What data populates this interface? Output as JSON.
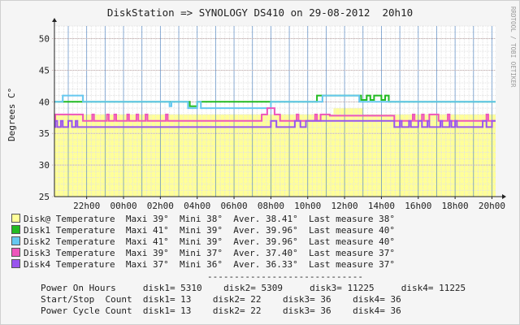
{
  "colors": {
    "background": "#f5f5f5",
    "plot_background": "#ffffff",
    "area_fill": "#ffff99",
    "grid_minor": "#e2e2e2",
    "grid_major": "#c9b2b2",
    "hour_lines": "#2a6bb8",
    "axis": "#222222"
  },
  "chart_data": {
    "type": "line",
    "title": "DiskStation => SYNOLOGY DS410 on 29-08-2012  20h10",
    "ylabel": "Degrees C°",
    "watermark": "RRDTOOL / TOBI OETIKER",
    "ylim": [
      25,
      52
    ],
    "yticks": [
      25,
      30,
      35,
      40,
      45,
      50
    ],
    "xlim": [
      20.25,
      44.2
    ],
    "xticks": [
      {
        "x": 22,
        "label": "22h00"
      },
      {
        "x": 24,
        "label": "00h00"
      },
      {
        "x": 26,
        "label": "02h00"
      },
      {
        "x": 28,
        "label": "04h00"
      },
      {
        "x": 30,
        "label": "06h00"
      },
      {
        "x": 32,
        "label": "08h00"
      },
      {
        "x": 34,
        "label": "10h00"
      },
      {
        "x": 36,
        "label": "12h00"
      },
      {
        "x": 38,
        "label": "14h00"
      },
      {
        "x": 40,
        "label": "16h00"
      },
      {
        "x": 42,
        "label": "18h00"
      },
      {
        "x": 44,
        "label": "20h00"
      }
    ],
    "grid": true,
    "series": [
      {
        "name": "Disk@ Temperature",
        "color": "#ffff99",
        "style": "area",
        "points": [
          [
            20.25,
            38
          ],
          [
            35.4,
            38
          ],
          [
            35.4,
            39
          ],
          [
            37.0,
            39
          ],
          [
            37.0,
            38
          ],
          [
            44.2,
            38
          ]
        ],
        "maxi": "39°",
        "mini": "38°",
        "aver": "38.41°",
        "last": "38°"
      },
      {
        "name": "Disk1 Temperature",
        "color": "#22bb22",
        "style": "line",
        "points": [
          [
            20.25,
            40
          ],
          [
            27.6,
            40
          ],
          [
            27.6,
            39.3
          ],
          [
            28.0,
            39.3
          ],
          [
            28.0,
            40
          ],
          [
            34.5,
            40
          ],
          [
            34.5,
            41
          ],
          [
            36.9,
            41
          ],
          [
            36.9,
            40.3
          ],
          [
            37.2,
            40.3
          ],
          [
            37.2,
            41
          ],
          [
            37.4,
            41
          ],
          [
            37.4,
            40.3
          ],
          [
            37.6,
            40.3
          ],
          [
            37.6,
            41
          ],
          [
            38.0,
            41
          ],
          [
            38.0,
            40.3
          ],
          [
            38.2,
            40.3
          ],
          [
            38.2,
            41
          ],
          [
            38.4,
            41
          ],
          [
            38.4,
            40
          ],
          [
            44.2,
            40
          ]
        ],
        "maxi": "41°",
        "mini": "39°",
        "aver": "39.96°",
        "last": "40°"
      },
      {
        "name": "Disk2 Temperature",
        "color": "#66c8f0",
        "style": "line",
        "points": [
          [
            20.25,
            40
          ],
          [
            20.7,
            40
          ],
          [
            20.7,
            41
          ],
          [
            21.8,
            41
          ],
          [
            21.8,
            40
          ],
          [
            26.5,
            40
          ],
          [
            26.5,
            39.3
          ],
          [
            26.6,
            39.3
          ],
          [
            26.6,
            40
          ],
          [
            27.5,
            40
          ],
          [
            27.5,
            39
          ],
          [
            28.0,
            39
          ],
          [
            28.0,
            40
          ],
          [
            28.2,
            40
          ],
          [
            28.2,
            39
          ],
          [
            32.0,
            39
          ],
          [
            32.0,
            40
          ],
          [
            34.8,
            40
          ],
          [
            34.8,
            41
          ],
          [
            36.8,
            41
          ],
          [
            36.8,
            40
          ],
          [
            44.2,
            40
          ]
        ],
        "maxi": "41°",
        "mini": "39°",
        "aver": "39.96°",
        "last": "40°"
      },
      {
        "name": "Disk3 Temperature",
        "color": "#ee55bb",
        "style": "line",
        "points": [
          [
            20.25,
            37
          ],
          [
            20.3,
            37
          ],
          [
            20.3,
            38
          ],
          [
            21.8,
            38
          ],
          [
            21.8,
            37
          ],
          [
            22.3,
            37
          ],
          [
            22.3,
            38
          ],
          [
            22.4,
            38
          ],
          [
            22.4,
            37
          ],
          [
            23.1,
            37
          ],
          [
            23.1,
            38
          ],
          [
            23.2,
            38
          ],
          [
            23.2,
            37
          ],
          [
            23.5,
            37
          ],
          [
            23.5,
            38
          ],
          [
            23.6,
            38
          ],
          [
            23.6,
            37
          ],
          [
            24.2,
            37
          ],
          [
            24.2,
            38
          ],
          [
            24.3,
            38
          ],
          [
            24.3,
            37
          ],
          [
            24.7,
            37
          ],
          [
            24.7,
            38
          ],
          [
            24.8,
            38
          ],
          [
            24.8,
            37
          ],
          [
            25.2,
            37
          ],
          [
            25.2,
            38
          ],
          [
            25.3,
            38
          ],
          [
            25.3,
            37
          ],
          [
            26.3,
            37
          ],
          [
            26.3,
            38
          ],
          [
            26.4,
            38
          ],
          [
            26.4,
            37
          ],
          [
            31.5,
            37
          ],
          [
            31.5,
            38
          ],
          [
            31.8,
            38
          ],
          [
            31.8,
            39
          ],
          [
            32.2,
            39
          ],
          [
            32.2,
            38
          ],
          [
            32.5,
            38
          ],
          [
            32.5,
            37
          ],
          [
            33.4,
            37
          ],
          [
            33.4,
            38
          ],
          [
            33.5,
            38
          ],
          [
            33.5,
            37
          ],
          [
            34.4,
            37
          ],
          [
            34.4,
            38
          ],
          [
            34.5,
            38
          ],
          [
            34.5,
            37
          ],
          [
            34.7,
            37
          ],
          [
            34.7,
            38
          ],
          [
            35.2,
            38
          ],
          [
            35.2,
            37.8
          ],
          [
            38.7,
            37.8
          ],
          [
            38.7,
            37
          ],
          [
            39.7,
            37
          ],
          [
            39.7,
            38
          ],
          [
            39.8,
            38
          ],
          [
            39.8,
            37
          ],
          [
            40.2,
            37
          ],
          [
            40.2,
            38
          ],
          [
            40.3,
            38
          ],
          [
            40.3,
            37
          ],
          [
            40.6,
            37
          ],
          [
            40.6,
            38
          ],
          [
            41.1,
            38
          ],
          [
            41.1,
            37
          ],
          [
            41.6,
            37
          ],
          [
            41.6,
            38
          ],
          [
            41.7,
            38
          ],
          [
            41.7,
            37
          ],
          [
            43.7,
            37
          ],
          [
            43.7,
            38
          ],
          [
            43.8,
            38
          ],
          [
            43.8,
            37
          ],
          [
            44.2,
            37
          ]
        ],
        "maxi": "39°",
        "mini": "37°",
        "aver": "37.40°",
        "last": "37°"
      },
      {
        "name": "Disk4 Temperature",
        "color": "#9955ee",
        "style": "line",
        "points": [
          [
            20.25,
            36
          ],
          [
            20.3,
            36
          ],
          [
            20.3,
            37
          ],
          [
            20.4,
            37
          ],
          [
            20.4,
            36
          ],
          [
            20.6,
            36
          ],
          [
            20.6,
            37
          ],
          [
            20.7,
            37
          ],
          [
            20.7,
            36
          ],
          [
            21.0,
            36
          ],
          [
            21.0,
            37
          ],
          [
            21.2,
            37
          ],
          [
            21.2,
            36
          ],
          [
            21.4,
            36
          ],
          [
            21.4,
            37
          ],
          [
            21.5,
            37
          ],
          [
            21.5,
            36
          ],
          [
            32.0,
            36
          ],
          [
            32.0,
            37
          ],
          [
            32.3,
            37
          ],
          [
            32.3,
            36
          ],
          [
            33.3,
            36
          ],
          [
            33.3,
            37
          ],
          [
            33.6,
            37
          ],
          [
            33.6,
            36
          ],
          [
            33.9,
            36
          ],
          [
            33.9,
            37
          ],
          [
            38.7,
            37
          ],
          [
            38.7,
            36
          ],
          [
            39.0,
            36
          ],
          [
            39.0,
            37
          ],
          [
            39.1,
            37
          ],
          [
            39.1,
            36
          ],
          [
            39.5,
            36
          ],
          [
            39.5,
            37
          ],
          [
            39.6,
            37
          ],
          [
            39.6,
            36
          ],
          [
            40.0,
            36
          ],
          [
            40.0,
            37
          ],
          [
            40.2,
            37
          ],
          [
            40.2,
            36
          ],
          [
            40.5,
            36
          ],
          [
            40.5,
            37
          ],
          [
            40.6,
            37
          ],
          [
            40.6,
            36
          ],
          [
            41.2,
            36
          ],
          [
            41.2,
            37
          ],
          [
            41.3,
            37
          ],
          [
            41.3,
            36
          ],
          [
            41.7,
            36
          ],
          [
            41.7,
            37
          ],
          [
            41.8,
            37
          ],
          [
            41.8,
            36
          ],
          [
            42.0,
            36
          ],
          [
            42.0,
            37
          ],
          [
            42.1,
            37
          ],
          [
            42.1,
            36
          ],
          [
            43.5,
            36
          ],
          [
            43.5,
            37
          ],
          [
            43.7,
            37
          ],
          [
            43.7,
            36
          ],
          [
            44.0,
            36
          ],
          [
            44.0,
            37
          ],
          [
            44.2,
            37
          ]
        ],
        "maxi": "37°",
        "mini": "36°",
        "aver": "36.33°",
        "last": "37°"
      }
    ]
  },
  "legend": [
    {
      "swatch": "#ffff99",
      "text": "Disk@ Temperature  Maxi 39°  Mini 38°  Aver. 38.41°  Last measure 38°"
    },
    {
      "swatch": "#22bb22",
      "text": "Disk1 Temperature  Maxi 41°  Mini 39°  Aver. 39.96°  Last measure 40°"
    },
    {
      "swatch": "#66c8f0",
      "text": "Disk2 Temperature  Maxi 41°  Mini 39°  Aver. 39.96°  Last measure 40°"
    },
    {
      "swatch": "#ee55bb",
      "text": "Disk3 Temperature  Maxi 39°  Mini 37°  Aver. 37.40°  Last measure 37°"
    },
    {
      "swatch": "#9955ee",
      "text": "Disk4 Temperature  Maxi 37°  Mini 36°  Aver. 36.33°  Last measure 37°"
    }
  ],
  "divider": "-----------------------------",
  "stats": [
    "Power On Hours     disk1= 5310    disk2= 5309     disk3= 11225     disk4= 11225",
    "Start/Stop  Count  disk1= 13    disk2= 22    disk3= 36    disk4= 36",
    "Power Cycle Count  disk1= 13    disk2= 22    disk3= 36    disk4= 36"
  ]
}
